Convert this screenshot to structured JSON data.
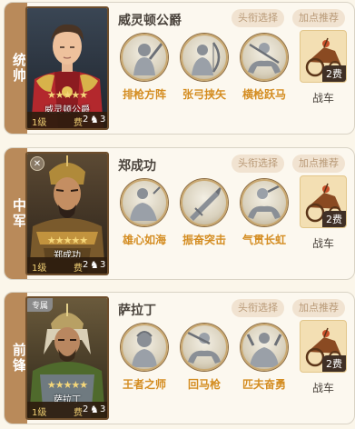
{
  "cards": [
    {
      "position": "统帅",
      "general": "威灵顿公爵",
      "portrait_name": "威灵顿公爵",
      "stars": "★★★★★",
      "level": "1级",
      "cost_label": "费",
      "cost_value": "2",
      "unit_value": "3",
      "badge": "",
      "title_btn": "头衔选择",
      "points_btn": "加点推荐",
      "skills": [
        "排枪方阵",
        "张弓挟矢",
        "横枪跃马"
      ],
      "vehicle": "战车",
      "vehicle_cost": "2费"
    },
    {
      "position": "中军",
      "general": "郑成功",
      "portrait_name": "郑成功",
      "stars": "★★★★★",
      "level": "1级",
      "cost_label": "费",
      "cost_value": "2",
      "unit_value": "3",
      "badge": "✕",
      "title_btn": "头衔选择",
      "points_btn": "加点推荐",
      "skills": [
        "雄心如海",
        "振奋突击",
        "气贯长虹"
      ],
      "vehicle": "战车",
      "vehicle_cost": "2费"
    },
    {
      "position": "前锋",
      "general": "萨拉丁",
      "portrait_name": "萨拉丁",
      "stars": "★★★★★",
      "level": "1级",
      "cost_label": "费",
      "cost_value": "2",
      "unit_value": "3",
      "badge": "专属",
      "title_btn": "头衔选择",
      "points_btn": "加点推荐",
      "skills": [
        "王者之师",
        "回马枪",
        "匹夫奋勇"
      ],
      "vehicle": "战车",
      "vehicle_cost": "2费"
    }
  ],
  "colors": {
    "band": "#b98a5a",
    "skill_label": "#d48d22",
    "pill_bg": "#f1e3d1",
    "pill_text": "#b89976"
  }
}
